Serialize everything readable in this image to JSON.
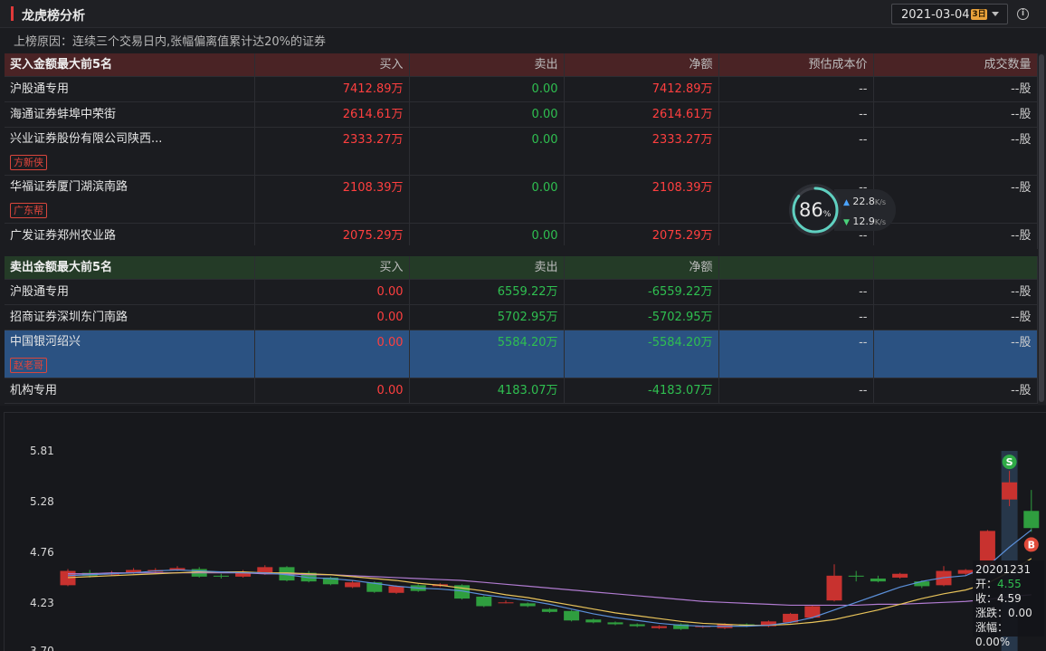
{
  "header": {
    "title": "龙虎榜分析",
    "date": "2021-03-04",
    "date_badge": "3日",
    "info_icon": "info-icon"
  },
  "reason": "上榜原因：连续三个交易日内,张幅偏离值累计达20%的证券",
  "buy_table": {
    "headers": [
      "买入金额最大前5名",
      "买入",
      "卖出",
      "净额",
      "预估成本价",
      "成交数量"
    ],
    "rows": [
      {
        "name": "沪股通专用",
        "buy": "7412.89万",
        "sell": "0.00",
        "net": "7412.89万",
        "cost": "--",
        "qty": "--股",
        "tag": ""
      },
      {
        "name": "海通证券蚌埠中荣街",
        "buy": "2614.61万",
        "sell": "0.00",
        "net": "2614.61万",
        "cost": "--",
        "qty": "--股",
        "tag": ""
      },
      {
        "name": "兴业证券股份有限公司陕西...",
        "buy": "2333.27万",
        "sell": "0.00",
        "net": "2333.27万",
        "cost": "--",
        "qty": "--股",
        "tag": "方新侠"
      },
      {
        "name": "华福证券厦门湖滨南路",
        "buy": "2108.39万",
        "sell": "0.00",
        "net": "2108.39万",
        "cost": "--",
        "qty": "--股",
        "tag": "广东帮"
      },
      {
        "name": "广发证券郑州农业路",
        "buy": "2075.29万",
        "sell": "0.00",
        "net": "2075.29万",
        "cost": "--",
        "qty": "--股",
        "tag": ""
      }
    ]
  },
  "sell_table": {
    "headers": [
      "卖出金额最大前5名",
      "买入",
      "卖出",
      "净额",
      "",
      ""
    ],
    "rows": [
      {
        "name": "沪股通专用",
        "buy": "0.00",
        "sell": "6559.22万",
        "net": "-6559.22万",
        "cost": "--",
        "qty": "--股",
        "tag": ""
      },
      {
        "name": "招商证券深圳东门南路",
        "buy": "0.00",
        "sell": "5702.95万",
        "net": "-5702.95万",
        "cost": "--",
        "qty": "--股",
        "tag": ""
      },
      {
        "name": "中国银河绍兴",
        "buy": "0.00",
        "sell": "5584.20万",
        "net": "-5584.20万",
        "cost": "--",
        "qty": "--股",
        "tag": "赵老哥",
        "selected": true
      },
      {
        "name": "机构专用",
        "buy": "0.00",
        "sell": "4183.07万",
        "net": "-4183.07万",
        "cost": "--",
        "qty": "--股",
        "tag": ""
      }
    ]
  },
  "network_widget": {
    "percent": "86",
    "percent_unit": "%",
    "up_speed": "22.8",
    "down_speed": "12.9",
    "speed_unit": "K/s"
  },
  "chart": {
    "y_labels": [
      "5.81",
      "5.28",
      "4.76",
      "4.23",
      "3.70"
    ],
    "sell_marker": "S",
    "buy_marker": "B",
    "tooltip": {
      "date": "20201231",
      "open_label": "开：",
      "open": "4.55",
      "close_label": "收：",
      "close": "4.59",
      "change_label": "涨跌：",
      "change": "0.00",
      "pct_label": "涨幅：",
      "pct": "0.00%"
    },
    "colors": {
      "up": "#c8322f",
      "down": "#2f9e3f",
      "ma5": "#5b8fd8",
      "ma10": "#e8c35a",
      "ma20": "#b07bd0"
    }
  },
  "chart_data": {
    "type": "candlestick",
    "y_range": [
      3.7,
      5.81
    ],
    "candles": [
      {
        "o": 4.4,
        "c": 4.55,
        "h": 4.57,
        "l": 4.39
      },
      {
        "o": 4.53,
        "c": 4.5,
        "h": 4.56,
        "l": 4.48
      },
      {
        "o": 4.52,
        "c": 4.52,
        "h": 4.55,
        "l": 4.5
      },
      {
        "o": 4.53,
        "c": 4.56,
        "h": 4.58,
        "l": 4.52
      },
      {
        "o": 4.54,
        "c": 4.56,
        "h": 4.58,
        "l": 4.53
      },
      {
        "o": 4.56,
        "c": 4.58,
        "h": 4.6,
        "l": 4.55
      },
      {
        "o": 4.57,
        "c": 4.49,
        "h": 4.59,
        "l": 4.48
      },
      {
        "o": 4.5,
        "c": 4.49,
        "h": 4.52,
        "l": 4.47
      },
      {
        "o": 4.49,
        "c": 4.54,
        "h": 4.56,
        "l": 4.48
      },
      {
        "o": 4.52,
        "c": 4.59,
        "h": 4.61,
        "l": 4.51
      },
      {
        "o": 4.59,
        "c": 4.45,
        "h": 4.6,
        "l": 4.44
      },
      {
        "o": 4.53,
        "c": 4.44,
        "h": 4.55,
        "l": 4.43
      },
      {
        "o": 4.48,
        "c": 4.41,
        "h": 4.49,
        "l": 4.4
      },
      {
        "o": 4.38,
        "c": 4.43,
        "h": 4.45,
        "l": 4.37
      },
      {
        "o": 4.43,
        "c": 4.33,
        "h": 4.44,
        "l": 4.32
      },
      {
        "o": 4.32,
        "c": 4.39,
        "h": 4.4,
        "l": 4.31
      },
      {
        "o": 4.4,
        "c": 4.34,
        "h": 4.41,
        "l": 4.33
      },
      {
        "o": 4.39,
        "c": 4.41,
        "h": 4.42,
        "l": 4.38
      },
      {
        "o": 4.4,
        "c": 4.26,
        "h": 4.41,
        "l": 4.25
      },
      {
        "o": 4.28,
        "c": 4.18,
        "h": 4.29,
        "l": 4.17
      },
      {
        "o": 4.22,
        "c": 4.22,
        "h": 4.24,
        "l": 4.21
      },
      {
        "o": 4.21,
        "c": 4.18,
        "h": 4.22,
        "l": 4.17
      },
      {
        "o": 4.15,
        "c": 4.12,
        "h": 4.16,
        "l": 4.11
      },
      {
        "o": 4.13,
        "c": 4.03,
        "h": 4.14,
        "l": 4.02
      },
      {
        "o": 4.04,
        "c": 4.01,
        "h": 4.05,
        "l": 4.0
      },
      {
        "o": 4.01,
        "c": 3.99,
        "h": 4.02,
        "l": 3.98
      },
      {
        "o": 3.99,
        "c": 3.97,
        "h": 4.0,
        "l": 3.96
      },
      {
        "o": 3.95,
        "c": 3.97,
        "h": 3.98,
        "l": 3.94
      },
      {
        "o": 3.99,
        "c": 3.94,
        "h": 4.0,
        "l": 3.93
      },
      {
        "o": 3.96,
        "c": 3.97,
        "h": 3.98,
        "l": 3.95
      },
      {
        "o": 3.95,
        "c": 3.99,
        "h": 4.0,
        "l": 3.94
      },
      {
        "o": 3.99,
        "c": 3.97,
        "h": 4.0,
        "l": 3.96
      },
      {
        "o": 3.97,
        "c": 4.02,
        "h": 4.03,
        "l": 3.96
      },
      {
        "o": 4.01,
        "c": 4.1,
        "h": 4.11,
        "l": 4.0
      },
      {
        "o": 4.06,
        "c": 4.18,
        "h": 4.19,
        "l": 4.05
      },
      {
        "o": 4.24,
        "c": 4.5,
        "h": 4.62,
        "l": 4.23
      },
      {
        "o": 4.5,
        "c": 4.49,
        "h": 4.55,
        "l": 4.44
      },
      {
        "o": 4.47,
        "c": 4.44,
        "h": 4.5,
        "l": 4.43
      },
      {
        "o": 4.48,
        "c": 4.52,
        "h": 4.53,
        "l": 4.47
      },
      {
        "o": 4.44,
        "c": 4.39,
        "h": 4.45,
        "l": 4.37
      },
      {
        "o": 4.4,
        "c": 4.55,
        "h": 4.6,
        "l": 4.39
      },
      {
        "o": 4.52,
        "c": 4.56,
        "h": 4.57,
        "l": 4.5
      },
      {
        "o": 4.61,
        "c": 4.97,
        "h": 4.98,
        "l": 4.58
      },
      {
        "o": 5.3,
        "c": 5.48,
        "h": 5.6,
        "l": 5.23
      },
      {
        "o": 5.18,
        "c": 5.0,
        "h": 5.4,
        "l": 4.96
      }
    ],
    "ma5": [
      4.5,
      4.51,
      4.52,
      4.53,
      4.55,
      4.56,
      4.55,
      4.54,
      4.53,
      4.53,
      4.51,
      4.48,
      4.47,
      4.45,
      4.42,
      4.39,
      4.37,
      4.36,
      4.34,
      4.3,
      4.27,
      4.24,
      4.2,
      4.15,
      4.1,
      4.06,
      4.03,
      4.0,
      3.98,
      3.97,
      3.97,
      3.97,
      3.98,
      4.01,
      4.06,
      4.14,
      4.22,
      4.3,
      4.38,
      4.44,
      4.48,
      4.5,
      4.6,
      4.8,
      4.98
    ],
    "ma10": [
      4.48,
      4.49,
      4.5,
      4.51,
      4.52,
      4.53,
      4.54,
      4.54,
      4.54,
      4.53,
      4.53,
      4.52,
      4.51,
      4.49,
      4.47,
      4.45,
      4.42,
      4.4,
      4.37,
      4.34,
      4.3,
      4.27,
      4.23,
      4.19,
      4.15,
      4.11,
      4.08,
      4.05,
      4.02,
      4.0,
      3.99,
      3.98,
      3.98,
      3.99,
      4.01,
      4.04,
      4.09,
      4.14,
      4.2,
      4.26,
      4.31,
      4.35,
      4.42,
      4.54,
      4.68
    ],
    "ma20": [
      4.52,
      4.52,
      4.53,
      4.53,
      4.53,
      4.53,
      4.53,
      4.53,
      4.53,
      4.52,
      4.52,
      4.51,
      4.51,
      4.5,
      4.49,
      4.48,
      4.47,
      4.46,
      4.45,
      4.43,
      4.41,
      4.39,
      4.37,
      4.35,
      4.33,
      4.31,
      4.29,
      4.27,
      4.25,
      4.23,
      4.22,
      4.21,
      4.2,
      4.19,
      4.19,
      4.19,
      4.19,
      4.2,
      4.2,
      4.21,
      4.22,
      4.23,
      4.25,
      4.28,
      4.3
    ]
  }
}
